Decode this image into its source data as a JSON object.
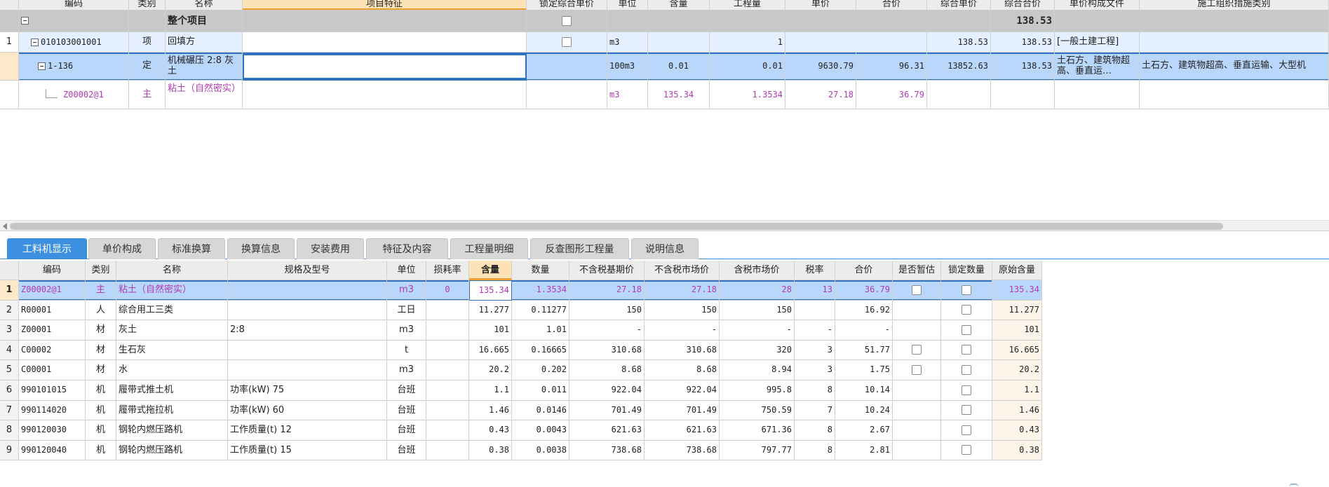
{
  "top": {
    "headers": [
      "编码",
      "类别",
      "名称",
      "项目特征",
      "锁定综合单价",
      "单位",
      "含量",
      "工程量",
      "单价",
      "合价",
      "综合单价",
      "综合合价",
      "单价构成文件",
      "施工组织措施类别"
    ],
    "total": {
      "label": "整个项目",
      "zhhj": "138.53"
    },
    "row1": {
      "num": "1",
      "code": "010103001001",
      "type": "项",
      "name": "回填方",
      "unit": "m3",
      "qty": "1",
      "zhdj": "138.53",
      "zhhj": "138.53",
      "file": "[一般土建工程]"
    },
    "row2": {
      "code": "1-136",
      "type": "定",
      "name": "机械碾压 2:8 灰土",
      "unit": "100m3",
      "content": "0.01",
      "qty": "0.01",
      "price": "9630.79",
      "sum": "96.31",
      "zhdj": "13852.63",
      "zhhj": "138.53",
      "file": "土石方、建筑物超高、垂直运…",
      "measure": "土石方、建筑物超高、垂直运输、大型机"
    },
    "row3": {
      "code": "Z00002@1",
      "type": "主",
      "name": "粘土（自然密实）",
      "unit": "m3",
      "content": "135.34",
      "qty": "1.3534",
      "price": "27.18",
      "sum": "36.79"
    }
  },
  "tabs": [
    "工料机显示",
    "单价构成",
    "标准换算",
    "换算信息",
    "安装费用",
    "特征及内容",
    "工程量明细",
    "反查图形工程量",
    "说明信息"
  ],
  "bottom": {
    "headers": [
      "编码",
      "类别",
      "名称",
      "规格及型号",
      "单位",
      "损耗率",
      "含量",
      "数量",
      "不含税基期价",
      "不含税市场价",
      "含税市场价",
      "税率",
      "合价",
      "是否暂估",
      "锁定数量",
      "原始含量"
    ],
    "rows": [
      {
        "n": "1",
        "code": "Z00002@1",
        "type": "主",
        "name": "粘土（自然密实）",
        "spec": "",
        "unit": "m3",
        "loss": "0",
        "content": "135.34",
        "qty": "1.3534",
        "base": "27.18",
        "market": "27.18",
        "taxm": "28",
        "rate": "13",
        "sum": "36.79",
        "est": true,
        "orig": "135.34"
      },
      {
        "n": "2",
        "code": "R00001",
        "type": "人",
        "name": "综合用工三类",
        "spec": "",
        "unit": "工日",
        "loss": "",
        "content": "11.277",
        "qty": "0.11277",
        "base": "150",
        "market": "150",
        "taxm": "150",
        "rate": "",
        "sum": "16.92",
        "est": false,
        "orig": "11.277"
      },
      {
        "n": "3",
        "code": "Z00001",
        "type": "材",
        "name": "灰土",
        "spec": "2:8",
        "unit": "m3",
        "loss": "",
        "content": "101",
        "qty": "1.01",
        "base": "-",
        "market": "-",
        "taxm": "-",
        "rate": "-",
        "sum": "-",
        "est": false,
        "orig": "101"
      },
      {
        "n": "4",
        "code": "C00002",
        "type": "材",
        "name": "生石灰",
        "spec": "",
        "unit": "t",
        "loss": "",
        "content": "16.665",
        "qty": "0.16665",
        "base": "310.68",
        "market": "310.68",
        "taxm": "320",
        "rate": "3",
        "sum": "51.77",
        "est": true,
        "orig": "16.665"
      },
      {
        "n": "5",
        "code": "C00001",
        "type": "材",
        "name": "水",
        "spec": "",
        "unit": "m3",
        "loss": "",
        "content": "20.2",
        "qty": "0.202",
        "base": "8.68",
        "market": "8.68",
        "taxm": "8.94",
        "rate": "3",
        "sum": "1.75",
        "est": true,
        "orig": "20.2"
      },
      {
        "n": "6",
        "code": "990101015",
        "type": "机",
        "name": "履带式推土机",
        "spec": "功率(kW) 75",
        "unit": "台班",
        "loss": "",
        "content": "1.1",
        "qty": "0.011",
        "base": "922.04",
        "market": "922.04",
        "taxm": "995.8",
        "rate": "8",
        "sum": "10.14",
        "est": false,
        "orig": "1.1"
      },
      {
        "n": "7",
        "code": "990114020",
        "type": "机",
        "name": "履带式拖拉机",
        "spec": "功率(kW) 60",
        "unit": "台班",
        "loss": "",
        "content": "1.46",
        "qty": "0.0146",
        "base": "701.49",
        "market": "701.49",
        "taxm": "750.59",
        "rate": "7",
        "sum": "10.24",
        "est": false,
        "orig": "1.46"
      },
      {
        "n": "8",
        "code": "990120030",
        "type": "机",
        "name": "钢轮内燃压路机",
        "spec": "工作质量(t) 12",
        "unit": "台班",
        "loss": "",
        "content": "0.43",
        "qty": "0.0043",
        "base": "621.63",
        "market": "621.63",
        "taxm": "671.36",
        "rate": "8",
        "sum": "2.67",
        "est": false,
        "orig": "0.43"
      },
      {
        "n": "9",
        "code": "990120040",
        "type": "机",
        "name": "钢轮内燃压路机",
        "spec": "工作质量(t) 15",
        "unit": "台班",
        "loss": "",
        "content": "0.38",
        "qty": "0.0038",
        "base": "738.68",
        "market": "738.68",
        "taxm": "797.77",
        "rate": "8",
        "sum": "2.81",
        "est": false,
        "orig": "0.38"
      }
    ]
  },
  "colors": {
    "selected": "#b8d7fb",
    "accent": "#3d8fe0",
    "purple": "#b23ab2",
    "header": "#ececec"
  }
}
